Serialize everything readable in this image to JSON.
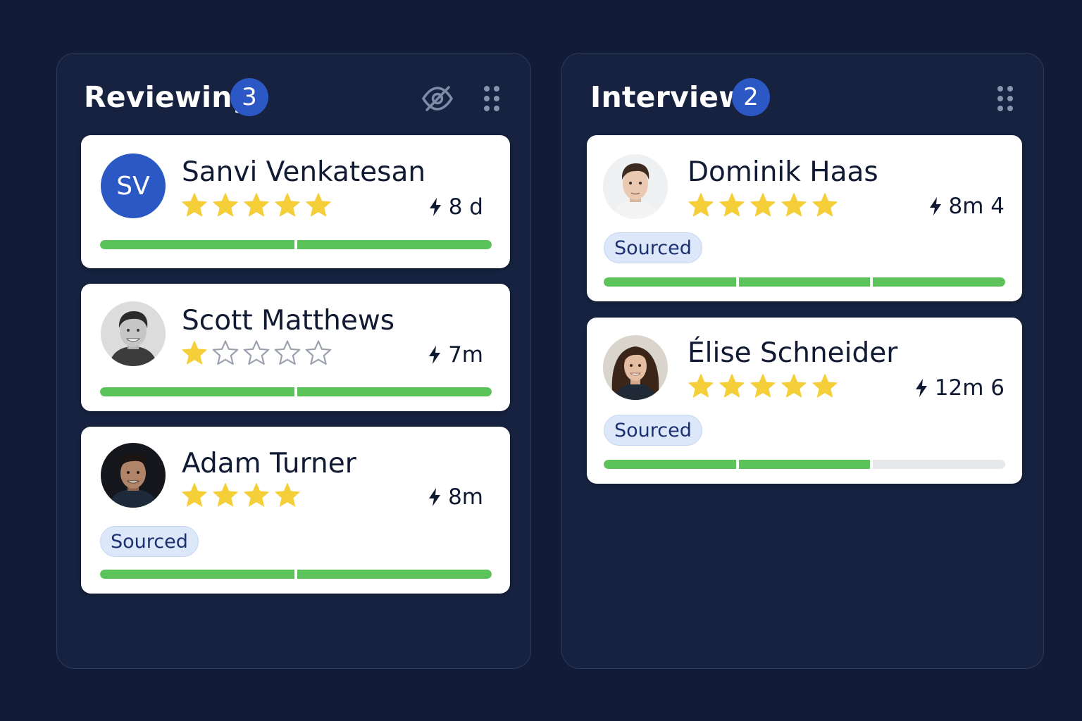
{
  "colors": {
    "background": "#121c36",
    "column": "#16223f",
    "badge": "#2b58c4",
    "star": "#f5cf3a",
    "progress_fill": "#5cc35a",
    "progress_track": "#e6e8ec",
    "tag_bg": "#dde7fa",
    "tag_text": "#1c3270"
  },
  "columns": [
    {
      "title": "Reviewing",
      "count": "3",
      "icons": [
        "eye-off-icon",
        "drag-handle-icon"
      ],
      "cards": [
        {
          "name": "Sanvi Venkatesan",
          "avatar": "initials",
          "initials": "SV",
          "rating": 5,
          "max_rating": 5,
          "time": "8 d",
          "tag": null,
          "progress": 1.0,
          "segments": 2
        },
        {
          "name": "Scott Matthews",
          "avatar": "photo",
          "rating": 1,
          "max_rating": 5,
          "time": "7m",
          "tag": null,
          "progress": 1.0,
          "segments": 2
        },
        {
          "name": "Adam Turner",
          "avatar": "photo",
          "rating": 4,
          "max_rating": 4,
          "time": "8m",
          "tag": "Sourced",
          "progress": 1.0,
          "segments": 2
        }
      ]
    },
    {
      "title": "Interview",
      "count": "2",
      "icons": [
        "drag-handle-icon"
      ],
      "cards": [
        {
          "name": "Dominik Haas",
          "avatar": "photo",
          "rating": 5,
          "max_rating": 5,
          "time": "8m 4",
          "tag": "Sourced",
          "progress": 1.0,
          "segments": 3
        },
        {
          "name": "Élise Schneider",
          "avatar": "photo",
          "rating": 5,
          "max_rating": 5,
          "time": "12m 6",
          "tag": "Sourced",
          "progress": 0.67,
          "segments": 3
        }
      ]
    }
  ]
}
